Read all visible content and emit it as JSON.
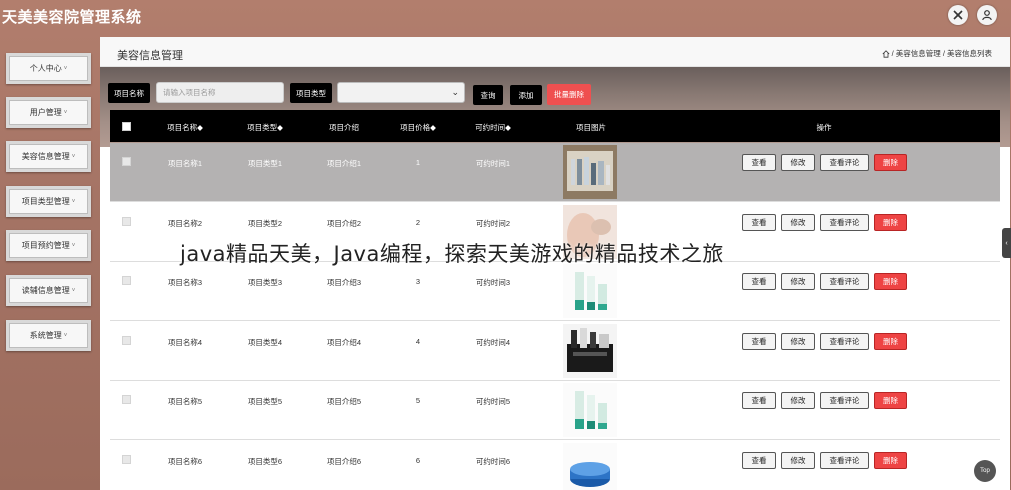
{
  "app": {
    "title": "天美美容院管理系统"
  },
  "topbar": {
    "icons": [
      "settings-cross-icon",
      "user-icon"
    ]
  },
  "sidebar": {
    "items": [
      {
        "label": "个人中心",
        "caret": "˅"
      },
      {
        "label": "用户管理",
        "caret": "˅"
      },
      {
        "label": "美容信息管理",
        "caret": "˅"
      },
      {
        "label": "项目类型管理",
        "caret": "˅"
      },
      {
        "label": "项目预约管理",
        "caret": "˅"
      },
      {
        "label": "读辅信息管理",
        "caret": "˅"
      },
      {
        "label": "系统管理",
        "caret": "˅"
      }
    ]
  },
  "header": {
    "page_title": "美容信息管理",
    "breadcrumb": [
      "/ 美容信息管理",
      "/ 美容信息列表"
    ]
  },
  "search": {
    "name_label": "项目名称",
    "name_placeholder": "请输入项目名称",
    "type_label": "项目类型",
    "type_selected": "",
    "query_btn": "查询",
    "add_btn": "添加",
    "batch_delete_btn": "批量删除"
  },
  "table": {
    "headers": [
      "项目名称◆",
      "项目类型◆",
      "项目介绍",
      "项目价格◆",
      "可约时间◆",
      "项目图片",
      "操作"
    ],
    "rows": [
      {
        "name": "项目名称1",
        "type": "项目类型1",
        "intro": "项目介绍1",
        "price": "1",
        "time": "可约时间1",
        "image": "cosmetics-brush-set"
      },
      {
        "name": "项目名称2",
        "type": "项目类型2",
        "intro": "项目介绍2",
        "price": "2",
        "time": "可约时间2",
        "image": "face-skin-care"
      },
      {
        "name": "项目名称3",
        "type": "项目类型3",
        "intro": "项目介绍3",
        "price": "3",
        "time": "可约时间3",
        "image": "green-tube-bottles"
      },
      {
        "name": "项目名称4",
        "type": "项目类型4",
        "intro": "项目介绍4",
        "price": "4",
        "time": "可约时间4",
        "image": "dark-cosmetic-set"
      },
      {
        "name": "项目名称5",
        "type": "项目类型5",
        "intro": "项目介绍5",
        "price": "5",
        "time": "可约时间5",
        "image": "green-tube-bottles"
      },
      {
        "name": "项目名称6",
        "type": "项目类型6",
        "intro": "项目介绍6",
        "price": "6",
        "time": "可约时间6",
        "image": "blue-cream-jar"
      }
    ],
    "actions": {
      "view": "查看",
      "edit": "修改",
      "view_comments": "查看评论",
      "delete": "删除"
    }
  },
  "overlay": {
    "caption": "java精品天美，Java编程，探索天美游戏的精品技术之旅"
  },
  "floating": {
    "top_label": "Top"
  },
  "colors": {
    "accent_red": "#ee4444",
    "sidebar_bg": "#a57465",
    "header_black": "#000000"
  }
}
